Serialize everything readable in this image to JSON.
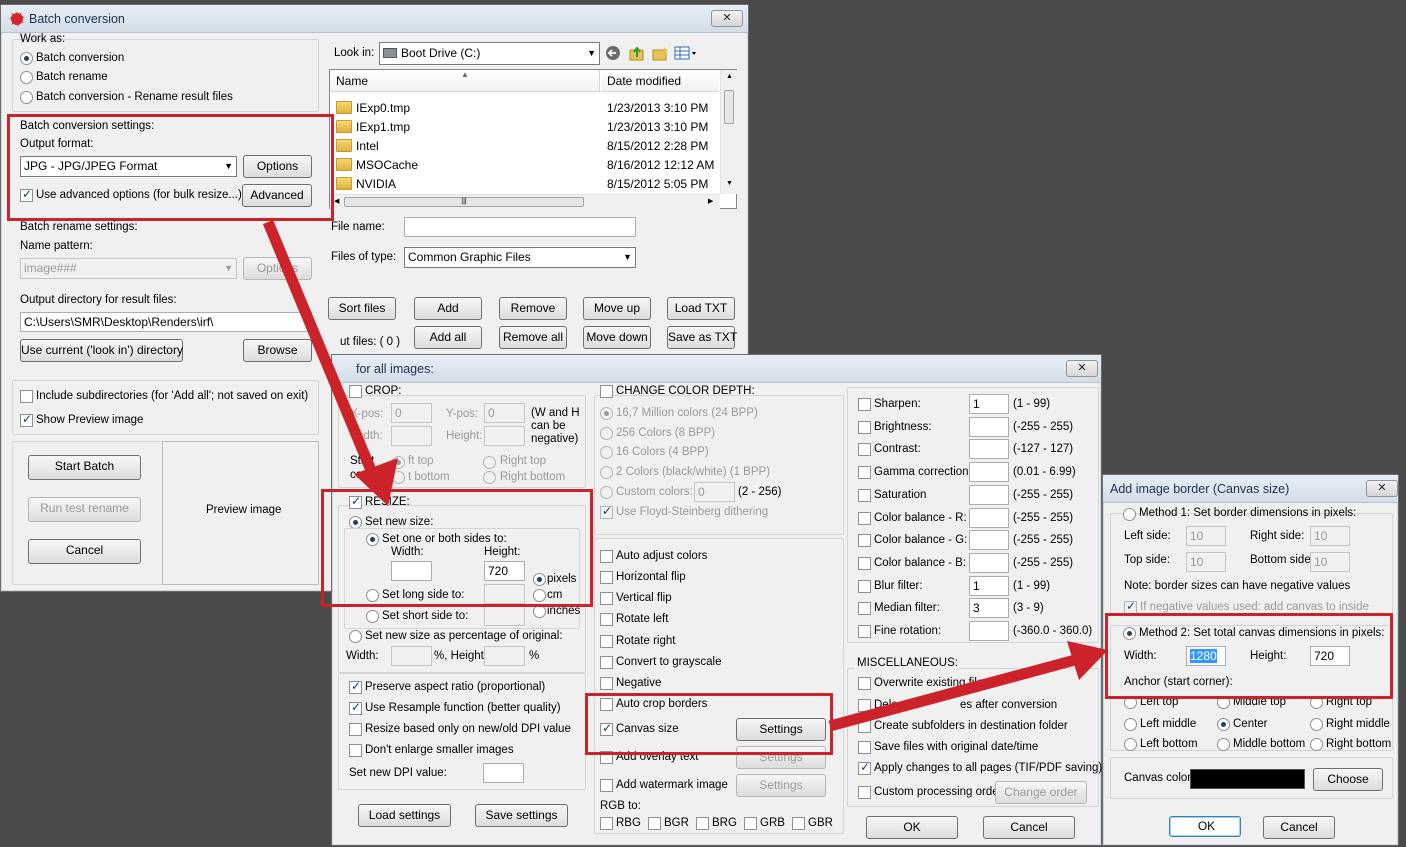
{
  "batch": {
    "title": "Batch conversion",
    "close": "✕",
    "work_as": "Work as:",
    "modes": [
      "Batch conversion",
      "Batch rename",
      "Batch conversion - Rename result files"
    ],
    "conv_settings": "Batch conversion settings:",
    "output_format_label": "Output format:",
    "output_format": "JPG - JPG/JPEG Format",
    "options": "Options",
    "use_advanced": "Use advanced options (for bulk resize...)",
    "advanced": "Advanced",
    "rename_settings": "Batch rename settings:",
    "name_pattern_label": "Name pattern:",
    "name_pattern": "image###",
    "rename_options": "Options",
    "output_dir_label": "Output directory for result files:",
    "output_dir": "C:\\Users\\SMR\\Desktop\\Renders\\irf\\",
    "use_current": "Use current ('look in') directory",
    "browse": "Browse",
    "include_sub": "Include subdirectories (for 'Add all'; not saved on exit)",
    "show_preview": "Show Preview image",
    "start": "Start Batch",
    "test": "Run test rename",
    "cancel": "Cancel",
    "preview": "Preview image",
    "look_in": "Look in:",
    "drive": "Boot Drive (C:)",
    "col_name": "Name",
    "col_date": "Date modified",
    "files": [
      {
        "name": "IExp0.tmp",
        "date": "1/23/2013 3:10 PM"
      },
      {
        "name": "IExp1.tmp",
        "date": "1/23/2013 3:10 PM"
      },
      {
        "name": "Intel",
        "date": "8/15/2012 2:28 PM"
      },
      {
        "name": "MSOCache",
        "date": "8/16/2012 12:12 AM"
      },
      {
        "name": "NVIDIA",
        "date": "8/15/2012 5:05 PM"
      }
    ],
    "file_name_label": "File name:",
    "files_type_label": "Files of type:",
    "files_type": "Common Graphic Files",
    "sort": "Sort files",
    "add": "Add",
    "remove": "Remove",
    "move_up": "Move up",
    "load_txt": "Load TXT",
    "add_all": "Add all",
    "remove_all": "Remove all",
    "move_down": "Move down",
    "save_txt": "Save as TXT",
    "input_files": "ut files: ( 0 )"
  },
  "adv": {
    "title": "for all images:",
    "close": "✕",
    "crop": "CROP:",
    "xpos": "X-pos:",
    "xval": "0",
    "ypos": "Y-pos:",
    "yval": "0",
    "wh_note_1": "(W and H",
    "wh_note_2": "can be",
    "wh_note_3": "negative)",
    "width": "Width:",
    "height": "Height:",
    "start_1": "Start",
    "start_2": "corner:",
    "left_top": "ft top",
    "right_top": "Right top",
    "left_bottom": "t bottom",
    "right_bottom": "Right bottom",
    "resize": "RESIZE:",
    "set_new_size": "Set new size:",
    "one_or_both": "Set one or both sides to:",
    "r_width": "Width:",
    "r_height": "Height:",
    "r_height_val": "720",
    "pixels": "pixels",
    "cm": "cm",
    "inches": "inches",
    "long_side": "Set long side to:",
    "short_side": "Set short side to:",
    "percentage": "Set new size as percentage of original:",
    "p_width": "Width:",
    "p_pct": "%, Height:",
    "p_pct2": "%",
    "preserve": "Preserve aspect ratio (proportional)",
    "resample": "Use Resample function (better quality)",
    "dpi_based": "Resize based only on new/old DPI value",
    "no_enlarge": "Don't enlarge smaller images",
    "new_dpi": "Set new DPI value:",
    "load_settings": "Load settings",
    "save_settings": "Save settings",
    "color_depth": "CHANGE COLOR DEPTH:",
    "depths": [
      "16,7 Million colors (24 BPP)",
      "256 Colors (8 BPP)",
      "16 Colors (4 BPP)",
      "2 Colors (black/white) (1 BPP)"
    ],
    "custom_colors": "Custom colors:",
    "custom_val": "0",
    "custom_range": "(2 - 256)",
    "floyd": "Use Floyd-Steinberg dithering",
    "ops": [
      "Auto adjust colors",
      "Horizontal flip",
      "Vertical flip",
      "Rotate left",
      "Rotate right",
      "Convert to grayscale",
      "Negative",
      "Auto crop borders"
    ],
    "canvas": "Canvas size",
    "canvas_settings": "Settings",
    "overlay": "Add overlay text",
    "overlay_settings": "Settings",
    "watermark": "Add watermark image",
    "watermark_settings": "Settings",
    "rgb_to": "RGB to:",
    "rgb": [
      "RBG",
      "BGR",
      "BRG",
      "GRB",
      "GBR"
    ],
    "filters": [
      {
        "label": "Sharpen:",
        "val": "1",
        "range": "(1  -  99)"
      },
      {
        "label": "Brightness:",
        "val": "",
        "range": "(-255  -  255)"
      },
      {
        "label": "Contrast:",
        "val": "",
        "range": "(-127  -  127)"
      },
      {
        "label": "Gamma correction:",
        "val": "",
        "range": "(0.01  -  6.99)"
      },
      {
        "label": "Saturation",
        "val": "",
        "range": "(-255  -  255)"
      },
      {
        "label": "Color balance - R:",
        "val": "",
        "range": "(-255  -  255)"
      },
      {
        "label": "Color balance - G:",
        "val": "",
        "range": "(-255  -  255)"
      },
      {
        "label": "Color balance - B:",
        "val": "",
        "range": "(-255  -  255)"
      },
      {
        "label": "Blur filter:",
        "val": "1",
        "range": "(1  -  99)"
      },
      {
        "label": "Median filter:",
        "val": "3",
        "range": "(3  -  9)"
      },
      {
        "label": "Fine rotation:",
        "val": "",
        "range": "(-360.0  -  360.0)"
      }
    ],
    "misc": "MISCELLANEOUS:",
    "misc_items": [
      "Overwrite existing files",
      "Dele",
      "es after conversion",
      "Create subfolders in destination folder",
      "Save files with original date/time",
      "Apply changes to all pages (TIF/PDF saving)",
      "Custom processing order"
    ],
    "change_order": "Change order",
    "ok": "OK",
    "cancel": "Cancel"
  },
  "border": {
    "title": "Add image border (Canvas size)",
    "close": "✕",
    "method1": "Method 1: Set border dimensions in pixels:",
    "left": "Left side:",
    "left_val": "10",
    "right": "Right side:",
    "right_val": "10",
    "top": "Top side:",
    "top_val": "10",
    "bottom": "Bottom side:",
    "bottom_val": "10",
    "note": "Note: border sizes can have negative values",
    "if_neg": "If negative values used: add canvas to inside",
    "method2": "Method 2: Set total canvas dimensions in pixels:",
    "width": "Width:",
    "width_val": "1280",
    "height": "Height:",
    "height_val": "720",
    "anchor": "Anchor (start corner):",
    "anchors": [
      "Left top",
      "Middle top",
      "Right top",
      "Left middle",
      "Center",
      "Right middle",
      "Left bottom",
      "Middle bottom",
      "Right bottom"
    ],
    "canvas_color": "Canvas color:",
    "choose": "Choose",
    "ok": "OK",
    "cancel": "Cancel"
  },
  "colors": {
    "highlight": "#cc2229",
    "canvas_color": "#000000",
    "selection": "#3399ff"
  }
}
